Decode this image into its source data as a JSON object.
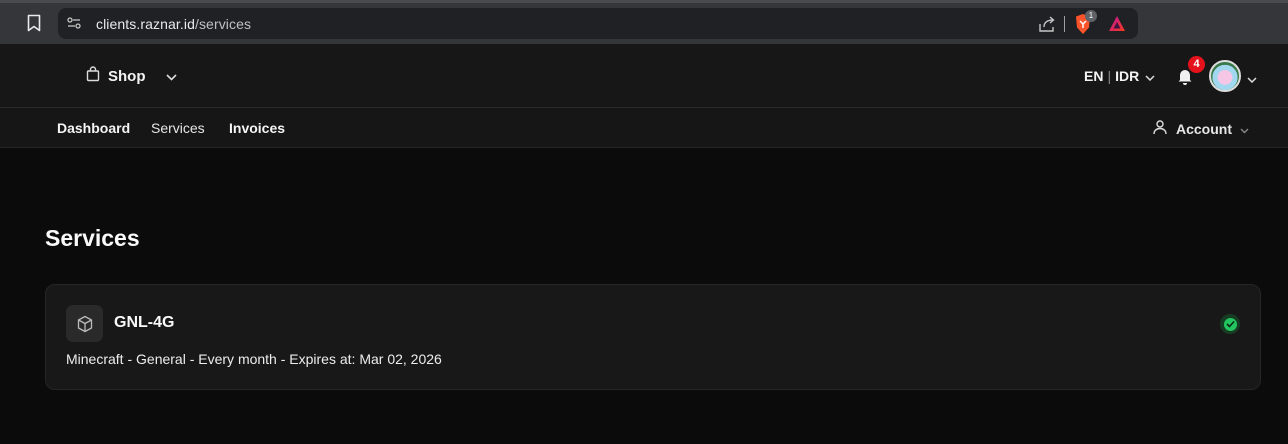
{
  "browser": {
    "url_host": "clients.raznar.id",
    "url_path": "/services",
    "shield_count": "1"
  },
  "header": {
    "shop_label": "Shop",
    "language": "EN",
    "currency": "IDR",
    "language_separator": "|",
    "notification_count": "4"
  },
  "nav": {
    "items": [
      {
        "label": "Dashboard"
      },
      {
        "label": "Services"
      },
      {
        "label": "Invoices"
      }
    ],
    "account_label": "Account"
  },
  "main": {
    "title": "Services",
    "services": [
      {
        "name": "GNL-4G",
        "details": "Minecraft - General - Every month - Expires at: Mar 02, 2026",
        "status": "active"
      }
    ]
  },
  "colors": {
    "status_active": "#22c55e",
    "notification_badge": "#e5121c",
    "background": "#0b0b0c"
  }
}
